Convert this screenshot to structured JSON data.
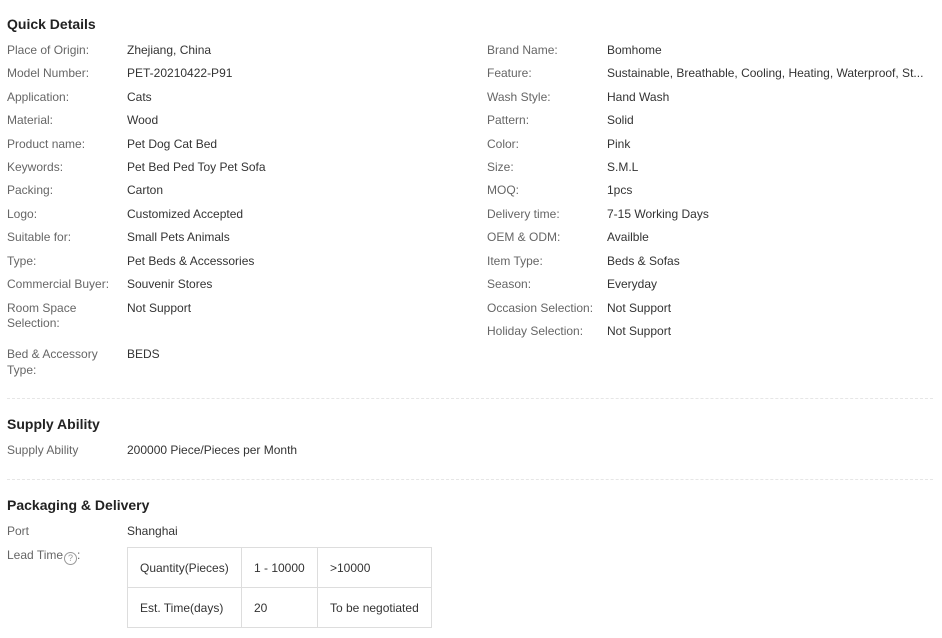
{
  "quick_details": {
    "title": "Quick Details",
    "left": [
      {
        "label": "Place of Origin:",
        "value": "Zhejiang, China"
      },
      {
        "label": "Model Number:",
        "value": "PET-20210422-P91"
      },
      {
        "label": "Application:",
        "value": "Cats"
      },
      {
        "label": "Material:",
        "value": "Wood"
      },
      {
        "label": "Product name:",
        "value": "Pet Dog Cat Bed"
      },
      {
        "label": "Keywords:",
        "value": "Pet Bed Ped Toy Pet Sofa"
      },
      {
        "label": "Packing:",
        "value": "Carton"
      },
      {
        "label": "Logo:",
        "value": "Customized Accepted"
      },
      {
        "label": "Suitable for:",
        "value": "Small Pets Animals"
      },
      {
        "label": "Type:",
        "value": "Pet Beds & Accessories"
      },
      {
        "label": "Commercial Buyer:",
        "value": "Souvenir Stores"
      },
      {
        "label_line1": "Room Space",
        "label_line2": "Selection:",
        "value": "Not Support"
      },
      {
        "label_line1": "Bed & Accessory",
        "label_line2": "Type:",
        "value": "BEDS"
      }
    ],
    "right": [
      {
        "label": "Brand Name:",
        "value": "Bomhome"
      },
      {
        "label": "Feature:",
        "value": "Sustainable, Breathable, Cooling, Heating, Waterproof, St..."
      },
      {
        "label": "Wash Style:",
        "value": "Hand Wash"
      },
      {
        "label": "Pattern:",
        "value": "Solid"
      },
      {
        "label": "Color:",
        "value": "Pink"
      },
      {
        "label": "Size:",
        "value": "S.M.L"
      },
      {
        "label": "MOQ:",
        "value": "1pcs"
      },
      {
        "label": "Delivery time:",
        "value": "7-15 Working Days"
      },
      {
        "label": "OEM & ODM:",
        "value": "Availble"
      },
      {
        "label": "Item Type:",
        "value": "Beds & Sofas"
      },
      {
        "label": "Season:",
        "value": "Everyday"
      },
      {
        "label": "Occasion Selection:",
        "value": "Not Support"
      },
      {
        "label": "Holiday Selection:",
        "value": "Not Support"
      }
    ]
  },
  "supply_ability": {
    "title": "Supply Ability",
    "label": "Supply Ability",
    "value": "200000 Piece/Pieces per Month"
  },
  "packaging_delivery": {
    "title": "Packaging & Delivery",
    "port_label": "Port",
    "port_value": "Shanghai",
    "lead_time_label": "Lead Time",
    "help_icon": "question-circle-icon",
    "help_glyph": "?",
    "lead_time_colon": ":",
    "table": [
      [
        "Quantity(Pieces)",
        "1 - 10000",
        ">10000"
      ],
      [
        "Est. Time(days)",
        "20",
        "To be negotiated"
      ]
    ]
  }
}
